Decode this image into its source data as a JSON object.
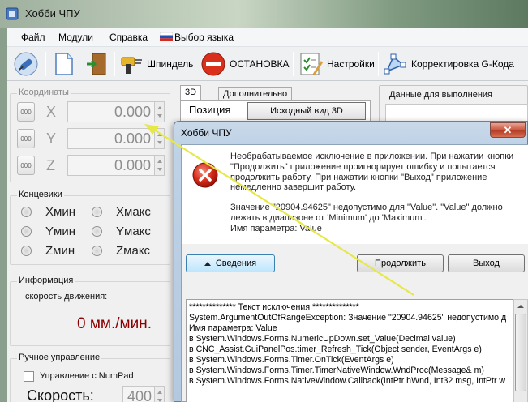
{
  "window": {
    "title": "Хобби ЧПУ"
  },
  "menu": [
    "Файл",
    "Модули",
    "Справка",
    "Выбор языка"
  ],
  "toolbar": {
    "spindle": "Шпиндель",
    "stop": "ОСТАНОВКА",
    "settings": "Настройки",
    "gcode_correction": "Корректировка G-Кода"
  },
  "coordinates": {
    "title": "Координаты",
    "zero_label": "000",
    "axes": [
      {
        "name": "X",
        "value": "0.000"
      },
      {
        "name": "Y",
        "value": "0.000"
      },
      {
        "name": "Z",
        "value": "0.000"
      }
    ]
  },
  "limits": {
    "title": "Концевики",
    "items": [
      "Xмин",
      "Xмакс",
      "Yмин",
      "Yмакс",
      "Zмин",
      "Zмакс"
    ]
  },
  "info": {
    "title": "Информация",
    "speed_label": "скорость движения:",
    "speed_value": "0 мм./мин."
  },
  "manual": {
    "title": "Ручное управление",
    "numpad_label": "Управление с NumPad",
    "speed_label": "Скорость:",
    "speed_value": "400"
  },
  "tabs": [
    "3D",
    "Дополнительно"
  ],
  "position": {
    "label": "Позиция",
    "view_button": "Исходный вид 3D"
  },
  "exec_data": {
    "title": "Данные для выполнения"
  },
  "dialog": {
    "title": "Хобби ЧПУ",
    "close": "✕",
    "message_1": "Необрабатываемое исключение в приложении. При нажатии кнопки \"Продолжить\" приложение проигнорирует ошибку и попытается продолжить работу. При нажатии кнопки \"Выход\" приложение немедленно завершит работу.",
    "message_2": "Значение \"20904.94625\" недопустимо для \"Value\". \"Value\" должно лежать в диапазоне от 'Minimum' до 'Maximum'.",
    "message_3": "Имя параметра: Value",
    "details_button": "Сведения",
    "continue_button": "Продолжить",
    "exit_button": "Выход",
    "details_lines": [
      "************** Текст исключения **************",
      "System.ArgumentOutOfRangeException: Значение \"20904.94625\" недопустимо д",
      "Имя параметра: Value",
      "   в System.Windows.Forms.NumericUpDown.set_Value(Decimal value)",
      "   в CNC_Assist.GuiPanelPos.timer_Refresh_Tick(Object sender, EventArgs e)",
      "   в System.Windows.Forms.Timer.OnTick(EventArgs e)",
      "   в System.Windows.Forms.Timer.TimerNativeWindow.WndProc(Message& m)",
      "   в System.Windows.Forms.NativeWindow.Callback(IntPtr hWnd, Int32 msg, IntPtr w"
    ]
  },
  "colors": {
    "speed_value": "#8b0000",
    "annotation_arrow": "#e6e84a",
    "stop_icon": "#d9301c"
  }
}
